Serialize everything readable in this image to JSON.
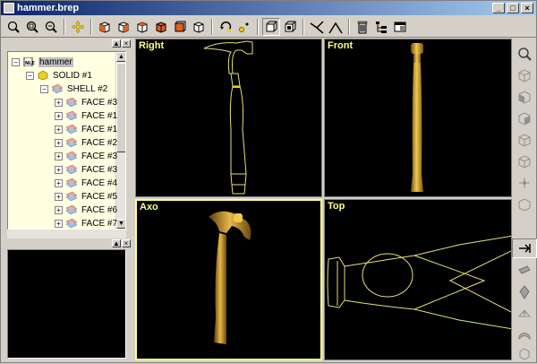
{
  "window": {
    "title": "hammer.brep",
    "min": "_",
    "max": "□",
    "close": "×"
  },
  "toolbar": {
    "tools": [
      "zoom-icon",
      "zoom-window-icon",
      "zoom-out-icon",
      "pan-icon",
      "view-front-icon",
      "view-back-icon",
      "view-left-icon",
      "view-right-icon",
      "view-top-icon",
      "view-iso-icon",
      "rotate-icon",
      "snap-icon",
      "box-icon",
      "shaded-icon",
      "wire-icon",
      "line-icon",
      "delete-icon",
      "tree-icon",
      "window-icon"
    ]
  },
  "tree_panel": {
    "items": [
      {
        "label": "hammer",
        "level": 0,
        "exp": "−",
        "icon": "file"
      },
      {
        "label": "SOLID #1",
        "level": 1,
        "exp": "−",
        "icon": "solid"
      },
      {
        "label": "SHELL #2",
        "level": 2,
        "exp": "−",
        "icon": "shell"
      },
      {
        "label": "FACE #3",
        "level": 3,
        "exp": "+",
        "icon": "face"
      },
      {
        "label": "FACE #1",
        "level": 3,
        "exp": "+",
        "icon": "face"
      },
      {
        "label": "FACE #1",
        "level": 3,
        "exp": "+",
        "icon": "face"
      },
      {
        "label": "FACE #2",
        "level": 3,
        "exp": "+",
        "icon": "face"
      },
      {
        "label": "FACE #3",
        "level": 3,
        "exp": "+",
        "icon": "face"
      },
      {
        "label": "FACE #3",
        "level": 3,
        "exp": "+",
        "icon": "face"
      },
      {
        "label": "FACE #4",
        "level": 3,
        "exp": "+",
        "icon": "face"
      },
      {
        "label": "FACE #5",
        "level": 3,
        "exp": "+",
        "icon": "face"
      },
      {
        "label": "FACE #6",
        "level": 3,
        "exp": "+",
        "icon": "face"
      },
      {
        "label": "FACE #7",
        "level": 3,
        "exp": "+",
        "icon": "face"
      }
    ]
  },
  "viewports": {
    "right": "Right",
    "front": "Front",
    "axo": "Axo",
    "top": "Top"
  },
  "colors": {
    "accent": "#ffff80",
    "wire": "#e8e070",
    "gold": "#c8961e"
  }
}
